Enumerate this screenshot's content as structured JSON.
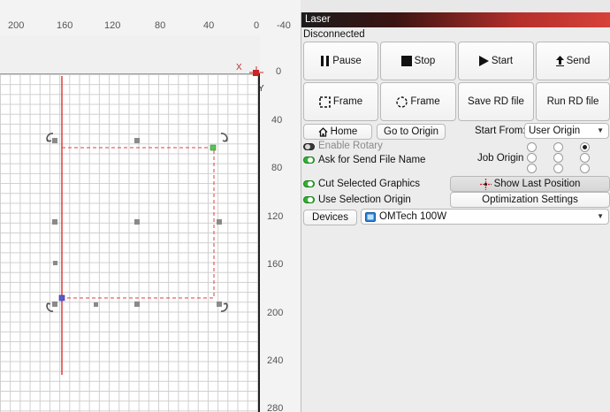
{
  "ruler": {
    "top_ticks": [
      "200",
      "160",
      "120",
      "80",
      "40",
      "0",
      "-40"
    ],
    "right_ticks": [
      "0",
      "40",
      "80",
      "120",
      "160",
      "200",
      "240",
      "280"
    ],
    "x_label": "X",
    "y_label": "Y"
  },
  "panel": {
    "title": "Laser",
    "status": "Disconnected",
    "buttons": {
      "pause": "Pause",
      "stop": "Stop",
      "start": "Start",
      "send": "Send",
      "frame": "Frame",
      "frame_circle": "Frame",
      "save_rd": "Save RD file",
      "run_rd": "Run RD file",
      "home": "Home",
      "go_to_origin": "Go to Origin",
      "show_last_position": "Show Last Position",
      "optimization_settings": "Optimization Settings",
      "devices": "Devices"
    },
    "start_from": {
      "label": "Start From:",
      "value": "User Origin"
    },
    "job_origin": {
      "label": "Job Origin",
      "selected": "top-right"
    },
    "toggles": {
      "enable_rotary": {
        "label": "Enable Rotary",
        "on": false,
        "enabled": false
      },
      "ask_file_name": {
        "label": "Ask for Send File Name",
        "on": true,
        "enabled": true
      },
      "cut_selected": {
        "label": "Cut Selected Graphics",
        "on": true,
        "enabled": true
      },
      "use_selection_origin": {
        "label": "Use Selection Origin",
        "on": true,
        "enabled": true
      }
    },
    "device": {
      "value": "OMTech 100W"
    }
  },
  "colors": {
    "accent_red": "#e23c3c",
    "toggle_on": "#2fb42f",
    "handle_green": "#56c456",
    "handle_blue": "#5a5ad0"
  }
}
